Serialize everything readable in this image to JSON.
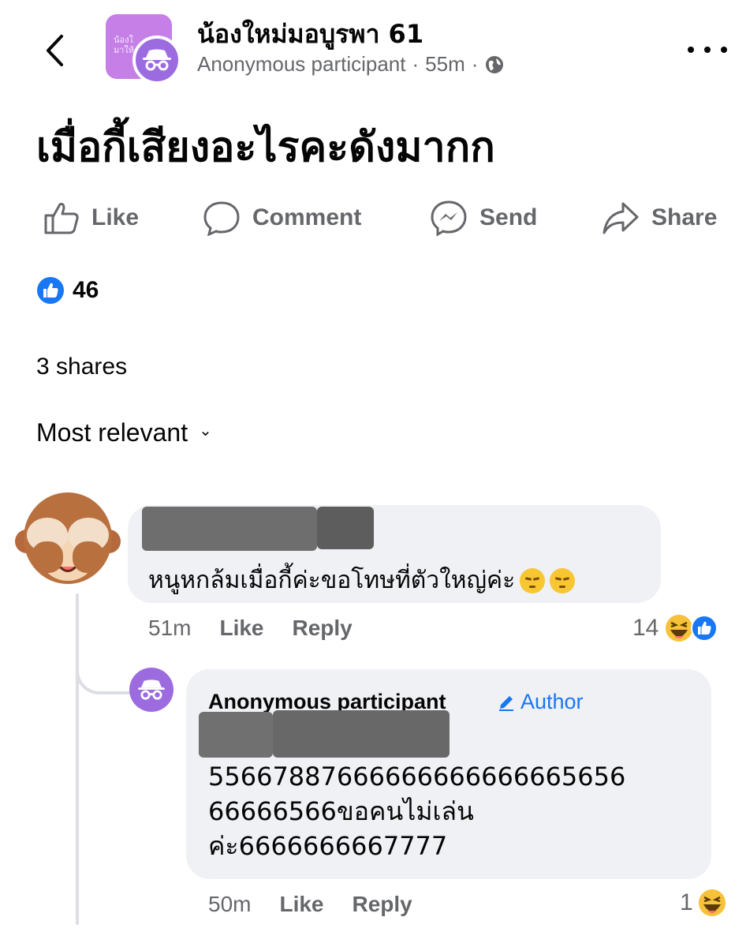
{
  "header": {
    "group_name": "น้องใหม่มอบูรพา 61",
    "avatar_text_line1": "น้องใ",
    "avatar_text_line2": "มาให้",
    "author": "Anonymous participant",
    "time": "55m",
    "separator": "·"
  },
  "post": {
    "text": "เมื่อกี้เสียงอะไรคะดังมากก"
  },
  "actions": {
    "like": "Like",
    "comment": "Comment",
    "send": "Send",
    "share": "Share"
  },
  "stats": {
    "likes": "46",
    "shares": "3 shares"
  },
  "sort": {
    "label": "Most relevant",
    "chevron": "⌄"
  },
  "comments": [
    {
      "text": "หนูหกล้มเมื่อกี้ค่ะขอโทษที่ตัวใหญ่ค่ะ",
      "time": "51m",
      "like": "Like",
      "reply": "Reply",
      "reaction_count": "14",
      "emoji": "pensive-face-emoji",
      "reactions": [
        "haha",
        "like"
      ]
    }
  ],
  "reply": {
    "author": "Anonymous participant",
    "badge": "Author",
    "lines": [
      "55667887666666666666665656",
      "66666566ขอคนไม่เล่น",
      "ค่ะ6666666667777"
    ],
    "time": "50m",
    "like": "Like",
    "reply": "Reply",
    "reaction_count": "1",
    "reactions": [
      "haha"
    ]
  },
  "colors": {
    "accent": "#1877f2",
    "muted": "#65676b",
    "bubble": "#eff1f5",
    "group_avatar": "#c57fe6",
    "anon_avatar": "#9c6be0"
  }
}
